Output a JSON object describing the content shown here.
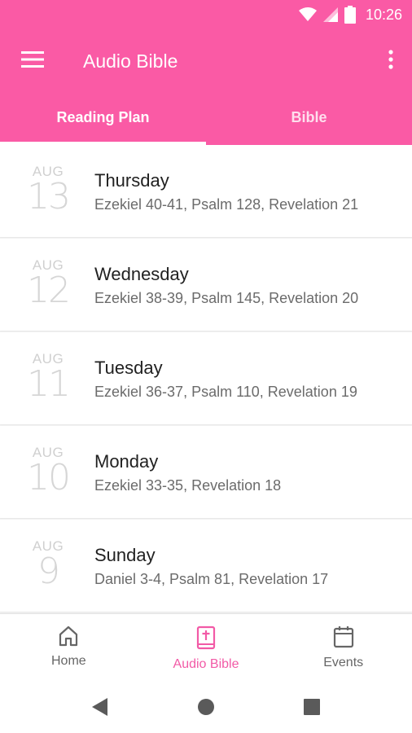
{
  "status_bar": {
    "time": "10:26",
    "icons": [
      "wifi-icon",
      "signal-icon",
      "battery-icon"
    ]
  },
  "app_bar": {
    "title": "Audio Bible",
    "menu_icon": "hamburger-menu-icon",
    "overflow_icon": "more-vert-icon"
  },
  "tabs": [
    {
      "label": "Reading Plan",
      "active": true
    },
    {
      "label": "Bible",
      "active": false
    }
  ],
  "reading_plan": [
    {
      "month": "AUG",
      "day": "13",
      "weekday": "Thursday",
      "readings": "Ezekiel 40-41, Psalm 128, Revelation 21"
    },
    {
      "month": "AUG",
      "day": "12",
      "weekday": "Wednesday",
      "readings": "Ezekiel 38-39, Psalm 145, Revelation 20"
    },
    {
      "month": "AUG",
      "day": "11",
      "weekday": "Tuesday",
      "readings": "Ezekiel 36-37, Psalm 110, Revelation 19"
    },
    {
      "month": "AUG",
      "day": "10",
      "weekday": "Monday",
      "readings": "Ezekiel 33-35, Revelation 18"
    },
    {
      "month": "AUG",
      "day": "9",
      "weekday": "Sunday",
      "readings": "Daniel 3-4, Psalm 81, Revelation 17"
    }
  ],
  "bottom_nav": [
    {
      "label": "Home",
      "icon": "home-icon",
      "active": false
    },
    {
      "label": "Audio Bible",
      "icon": "bible-icon",
      "active": true
    },
    {
      "label": "Events",
      "icon": "calendar-icon",
      "active": false
    }
  ],
  "system_nav": [
    "back-icon",
    "home-circle-icon",
    "recents-icon"
  ],
  "colors": {
    "primary": "#fa5aa5",
    "active_nav": "#f25aa6",
    "date_gray": "#d0d0d0",
    "secondary_text": "#6b6b6b"
  }
}
